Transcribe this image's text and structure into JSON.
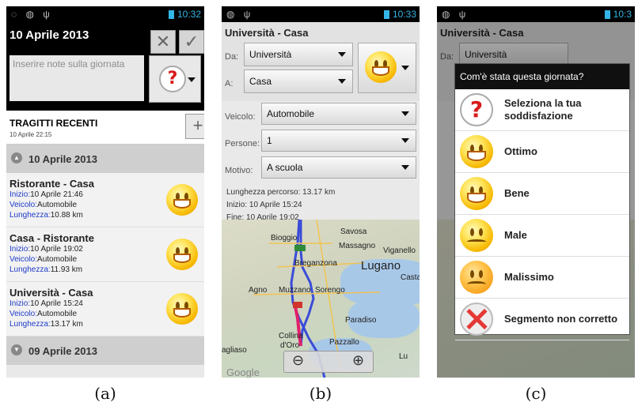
{
  "panel_a": {
    "status_time": "10:32",
    "date": "10 Aprile 2013",
    "note_placeholder": "Inserire note sulla giornata",
    "recent_title": "TRAGITTI RECENTI",
    "recent_subtitle": "10 Aprile 22:15",
    "add_glyph": "+",
    "cancel_glyph": "✕",
    "confirm_glyph": "✓",
    "day1": "10 Aprile 2013",
    "day2": "09 Aprile 2013",
    "trips": [
      {
        "title": "Ristorante - Casa",
        "inizio_label": "Inizio:",
        "inizio": "10 Aprile 21:46",
        "veicolo_label": "Veicolo:",
        "veicolo": "Automobile",
        "lunghezza_label": "Lunghezza:",
        "lunghezza": "10.88 km",
        "mood": "ottimo"
      },
      {
        "title": "Casa - Ristorante",
        "inizio_label": "Inizio:",
        "inizio": "10 Aprile 19:02",
        "veicolo_label": "Veicolo:",
        "veicolo": "Automobile",
        "lunghezza_label": "Lunghezza:",
        "lunghezza": "11.93 km",
        "mood": "ottimo"
      },
      {
        "title": "Università - Casa",
        "inizio_label": "Inizio:",
        "inizio": "10 Aprile 15:24",
        "veicolo_label": "Veicolo:",
        "veicolo": "Automobile",
        "lunghezza_label": "Lunghezza:",
        "lunghezza": "13.17 km",
        "mood": "ottimo"
      }
    ]
  },
  "panel_b": {
    "status_time": "10:33",
    "title": "Università - Casa",
    "da_label": "Da:",
    "da_value": "Università",
    "a_label": "A:",
    "a_value": "Casa",
    "veicolo_label": "Veicolo:",
    "veicolo_value": "Automobile",
    "persone_label": "Persone:",
    "persone_value": "1",
    "motivo_label": "Motivo:",
    "motivo_value": "A scuola",
    "lunghezza": "Lunghezza percorso:  13.17 km",
    "inizio": "Inizio:  10 Aprile 15:24",
    "fine": "Fine:   10 Aprile 19:02",
    "map_labels": [
      "Savosa",
      "Bioggio",
      "Massagno",
      "Viganello",
      "Breganzona",
      "Lugano",
      "Agno",
      "Muzzano",
      "Sorengo",
      "Casta",
      "Paradiso",
      "Collina",
      "d'Oro",
      "Pazzallo",
      "agliaso",
      "Lu",
      "Google"
    ]
  },
  "panel_c": {
    "status_time": "10:3",
    "dialog_title": "Com'è stata questa giornata?",
    "options": [
      {
        "label": "Seleziona la tua soddisfazione",
        "icon": "question-icon"
      },
      {
        "label": "Ottimo",
        "icon": "smiley-big-grin-icon"
      },
      {
        "label": "Bene",
        "icon": "smiley-smile-icon"
      },
      {
        "label": "Male",
        "icon": "smiley-sad-icon"
      },
      {
        "label": "Malissimo",
        "icon": "smiley-angry-icon"
      },
      {
        "label": "Segmento non corretto",
        "icon": "crossed-out-icon"
      }
    ],
    "bg_title": "Università - Casa",
    "bg_da": "Da:",
    "bg_da_value": "Università"
  },
  "captions": [
    "(a)",
    "(b)",
    "(c)"
  ],
  "colors": {
    "accent": "#33b5e5",
    "link_blue": "#1e3cc8",
    "route_blue": "#3a4cd8",
    "route_pink": "#e0206a"
  }
}
